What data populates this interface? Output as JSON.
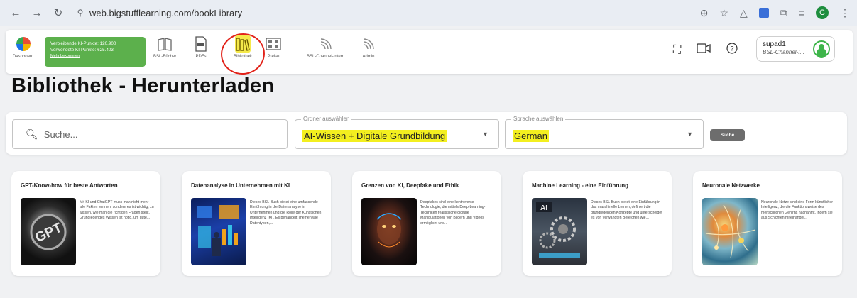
{
  "browser": {
    "url": "web.bigstufflearning.com/bookLibrary",
    "profile_initial": "C"
  },
  "appbar": {
    "items": [
      {
        "label": "Dashboard"
      },
      {
        "label": "BSL-Bücher"
      },
      {
        "label": "PDFs"
      },
      {
        "label": "Bibliothek"
      },
      {
        "label": "Preise"
      },
      {
        "label": "BSL-Channel-Intern"
      },
      {
        "label": "Admin"
      }
    ],
    "ki": {
      "remaining": "Verbleibende KI-Punkte: 120.900",
      "used": "Verwendete KI-Punkte: 625.403",
      "link": "Mehr bekommen"
    },
    "user": {
      "name": "supad1",
      "sub": "BSL-Channel-I..."
    }
  },
  "page": {
    "title": "Bibliothek - Herunterladen"
  },
  "filters": {
    "search_placeholder": "Suche...",
    "folder_label": "Ordner auswählen",
    "folder_value": "AI-Wissen + Digitale Grundbildung",
    "lang_label": "Sprache auswählen",
    "lang_value": "German",
    "search_button": "Suche"
  },
  "books": [
    {
      "title": "GPT-Know-how für beste Antworten",
      "desc": "Mit KI und ChatGPT muss man nicht mehr alle Fakten kennen, sondern es ist wichtig, zu wissen, wie man die richtigen Fragen stellt. Grundlegendes Wissen ist nötig, um gute..."
    },
    {
      "title": "Datenanalyse in Unternehmen mit KI",
      "desc": "Dieses BSL-Buch bietet eine umfassende Einführung in die Datenanalyse in Unternehmen und die Rolle der Künstlichen Intelligenz (KI). Es behandelt Themen wie Datentypen,..."
    },
    {
      "title": "Grenzen von KI, Deepfake und Ethik",
      "desc": "Deepfakes sind eine kontroverse Technologie, die mittels Deep-Learning-Techniken realistische digitale Manipulationen von Bildern und Videos ermöglicht und..."
    },
    {
      "title": "Machine Learning - eine Einführung",
      "desc": "Dieses BSL-Buch bietet eine Einführung in das maschinelle Lernen, definiert die grundlegenden Konzepte und unterscheidet es von verwandten Bereichen wie..."
    },
    {
      "title": "Neuronale Netzwerke",
      "desc": "Neuronale Netze sind eine Form künstlicher Intelligenz, die die Funktionsweise des menschlichen Gehirns nachahmt, indem sie aus Schichten miteinander..."
    }
  ]
}
